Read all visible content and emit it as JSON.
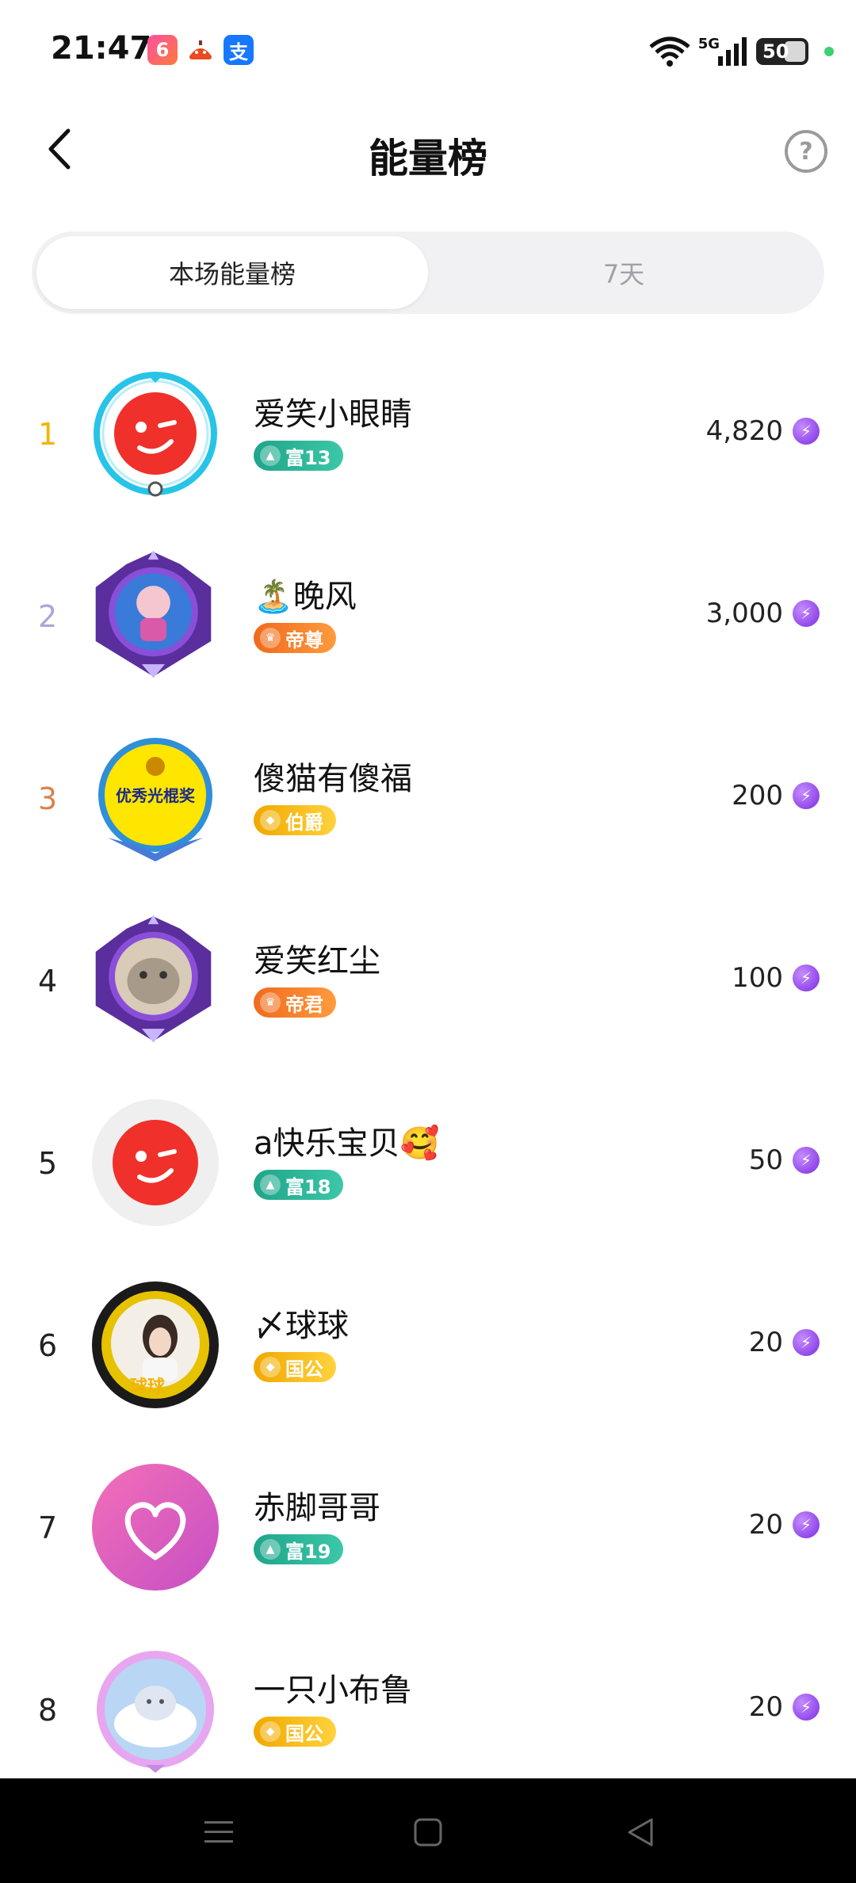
{
  "status": {
    "time": "21:47",
    "network": "5G",
    "battery": "50",
    "apps": [
      {
        "icon": "app6-icon",
        "glyph": "6",
        "color": "#ea3b8a"
      },
      {
        "icon": "taobao-icon",
        "glyph": "",
        "color": "#e94a1f"
      },
      {
        "icon": "alipay-icon",
        "glyph": "支",
        "color": "#1677ff"
      }
    ]
  },
  "header": {
    "title": "能量榜",
    "help_glyph": "?"
  },
  "tabs": [
    {
      "label": "本场能量榜",
      "active": true
    },
    {
      "label": "7天",
      "active": false
    }
  ],
  "ranking": [
    {
      "rank": "1",
      "name": "爱笑小眼睛",
      "badge": "富13",
      "badge_type": "rich",
      "value": "4,820",
      "rank_color": "#f2b400"
    },
    {
      "rank": "2",
      "name": "🏝️晚风",
      "badge": "帝尊",
      "badge_type": "orange",
      "value": "3,000",
      "rank_color": "#a8a8d8"
    },
    {
      "rank": "3",
      "name": "傻猫有傻福",
      "badge": "伯爵",
      "badge_type": "gold",
      "value": "200",
      "rank_color": "#d9824a"
    },
    {
      "rank": "4",
      "name": "爱笑红尘",
      "badge": "帝君",
      "badge_type": "orange",
      "value": "100",
      "rank_color": "#222222"
    },
    {
      "rank": "5",
      "name": "a快乐宝贝🥰",
      "badge": "富18",
      "badge_type": "rich",
      "value": "50",
      "rank_color": "#222222"
    },
    {
      "rank": "6",
      "name": "〆球球",
      "badge": "国公",
      "badge_type": "gold",
      "value": "20",
      "rank_color": "#222222"
    },
    {
      "rank": "7",
      "name": "赤脚哥哥",
      "badge": "富19",
      "badge_type": "rich",
      "value": "20",
      "rank_color": "#222222"
    },
    {
      "rank": "8",
      "name": "一只小布鲁",
      "badge": "国公",
      "badge_type": "gold",
      "value": "20",
      "rank_color": "#222222"
    }
  ],
  "avatar_text": {
    "row3": "优秀光棍奖",
    "row6": "球球"
  },
  "energy_glyph": "⚡"
}
